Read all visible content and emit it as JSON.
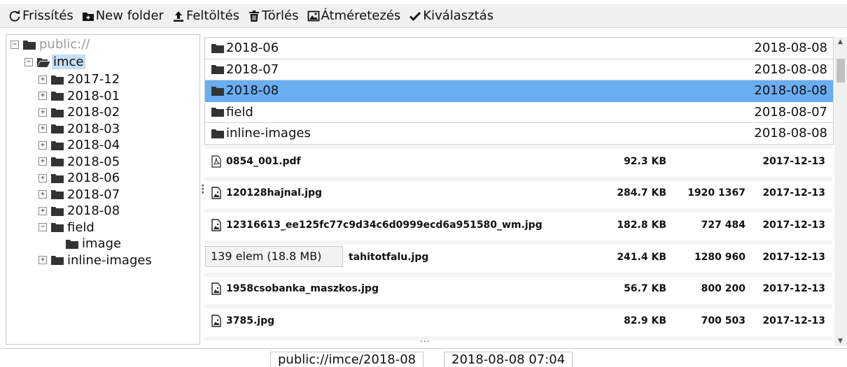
{
  "toolbar": {
    "refresh": "Frissítés",
    "new_folder": "New folder",
    "upload": "Feltöltés",
    "delete": "Törlés",
    "resize": "Átméretezés",
    "select": "Kiválasztás"
  },
  "tree": {
    "root": "public://",
    "imce": "imce",
    "folders": [
      "2017-12",
      "2018-01",
      "2018-02",
      "2018-03",
      "2018-04",
      "2018-05",
      "2018-06",
      "2018-07",
      "2018-08"
    ],
    "field": "field",
    "image": "image",
    "inline": "inline-images"
  },
  "dirs": [
    {
      "name": "2018-06",
      "date": "2018-08-08"
    },
    {
      "name": "2018-07",
      "date": "2018-08-08"
    },
    {
      "name": "2018-08",
      "date": "2018-08-08"
    },
    {
      "name": "field",
      "date": "2018-08-07"
    },
    {
      "name": "inline-images",
      "date": "2018-08-08"
    }
  ],
  "files": [
    {
      "name": "0854_001.pdf",
      "size": "92.3 KB",
      "dims": "",
      "date": "2017-12-13",
      "icon": "pdf-icon"
    },
    {
      "name": "120128hajnal.jpg",
      "size": "284.7 KB",
      "dims": "1920 1367",
      "date": "2017-12-13",
      "icon": "image-file-icon"
    },
    {
      "name": "12316613_ee125fc77c9d34c6d0999ecd6a951580_wm.jpg",
      "size": "182.8 KB",
      "dims": "727 484",
      "date": "2017-12-13",
      "icon": "image-file-icon"
    },
    {
      "name": "tahitotfalu.jpg",
      "size": "241.4 KB",
      "dims": "1280 960",
      "date": "2017-12-13",
      "icon": "image-file-icon"
    },
    {
      "name": "1958csobanka_maszkos.jpg",
      "size": "56.7 KB",
      "dims": "800 200",
      "date": "2017-12-13",
      "icon": "image-file-icon"
    },
    {
      "name": "3785.jpg",
      "size": "82.9 KB",
      "dims": "700 503",
      "date": "2017-12-13",
      "icon": "image-file-icon"
    }
  ],
  "tooltip": "139 elem (18.8 MB)",
  "status": {
    "path": "public://imce/2018-08",
    "datetime": "2018-08-08 07:04"
  },
  "colors": {
    "selected_row": "#6aaef2",
    "selected_tree": "#c7def3",
    "toolbar_bg": "#f0f0f0"
  }
}
